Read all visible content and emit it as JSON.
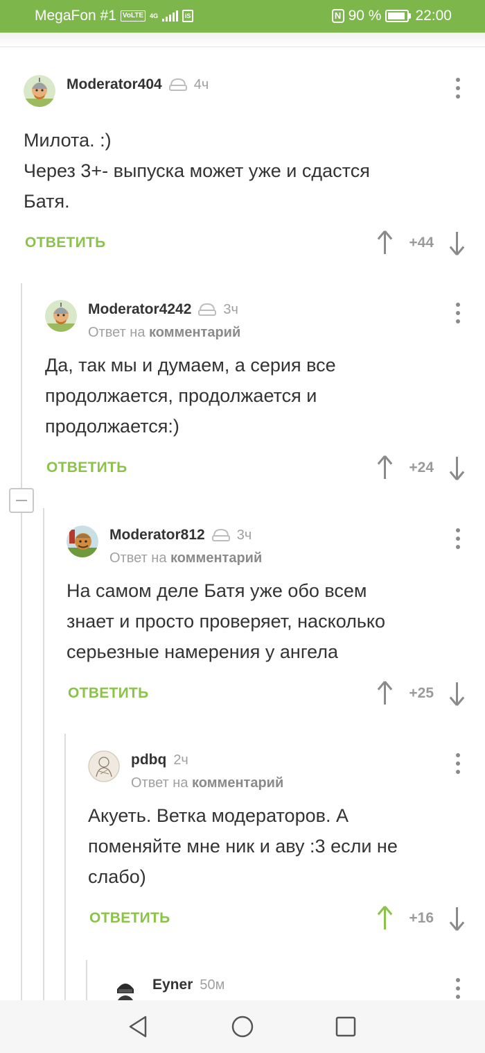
{
  "status_bar": {
    "carrier": "MegaFon #1",
    "volte": "VoLTE",
    "network": "4G",
    "sim_label": "iS",
    "nfc": "N",
    "battery": "90 %",
    "battery_level": 0.9,
    "time": "22:00"
  },
  "comments": [
    {
      "author": "Moderator404",
      "time": "4ч",
      "reply_to": null,
      "text_lines": [
        "Милота. :)",
        "Через 3+- выпуска может уже и сдастся",
        "Батя."
      ],
      "reply_label": "ОТВЕТИТЬ",
      "score": "+44",
      "avatar": "knight-avatar",
      "badge": "moderator-hat-icon"
    },
    {
      "author": "Moderator4242",
      "time": "3ч",
      "reply_to_prefix": "Ответ на",
      "reply_to_link": "комментарий",
      "text_lines": [
        "Да, так мы и думаем, а серия все",
        "продолжается, продолжается и",
        "продолжается:)"
      ],
      "reply_label": "ОТВЕТИТЬ",
      "score": "+24",
      "avatar": "knight-avatar",
      "badge": "moderator-hat-icon"
    },
    {
      "author": "Moderator812",
      "time": "3ч",
      "reply_to_prefix": "Ответ на",
      "reply_to_link": "комментарий",
      "text_lines": [
        "На самом деле Батя уже обо всем",
        "знает и просто проверяет, насколько",
        "серьезные намерения у ангела"
      ],
      "reply_label": "ОТВЕТИТЬ",
      "score": "+25",
      "avatar": "knight-avatar",
      "badge": "moderator-hat-icon"
    },
    {
      "author": "pdbq",
      "time": "2ч",
      "reply_to_prefix": "Ответ на",
      "reply_to_link": "комментарий",
      "text_lines": [
        "Акуеть. Ветка модераторов. А",
        "поменяйте мне ник и аву :3 если не",
        "слабо)"
      ],
      "reply_label": "ОТВЕТИТЬ",
      "score": "+16",
      "upvoted": true,
      "avatar": "sketch-avatar"
    },
    {
      "author": "Eyner",
      "time": "50м",
      "avatar": "soldier-avatar"
    }
  ],
  "colors": {
    "accent": "#8bc34a",
    "status_bar": "#7db64a",
    "upvoted": "#8bc34a",
    "muted": "#9a9a9a"
  },
  "navbar": {
    "back": "back-icon",
    "home": "home-icon",
    "recents": "recents-icon"
  }
}
